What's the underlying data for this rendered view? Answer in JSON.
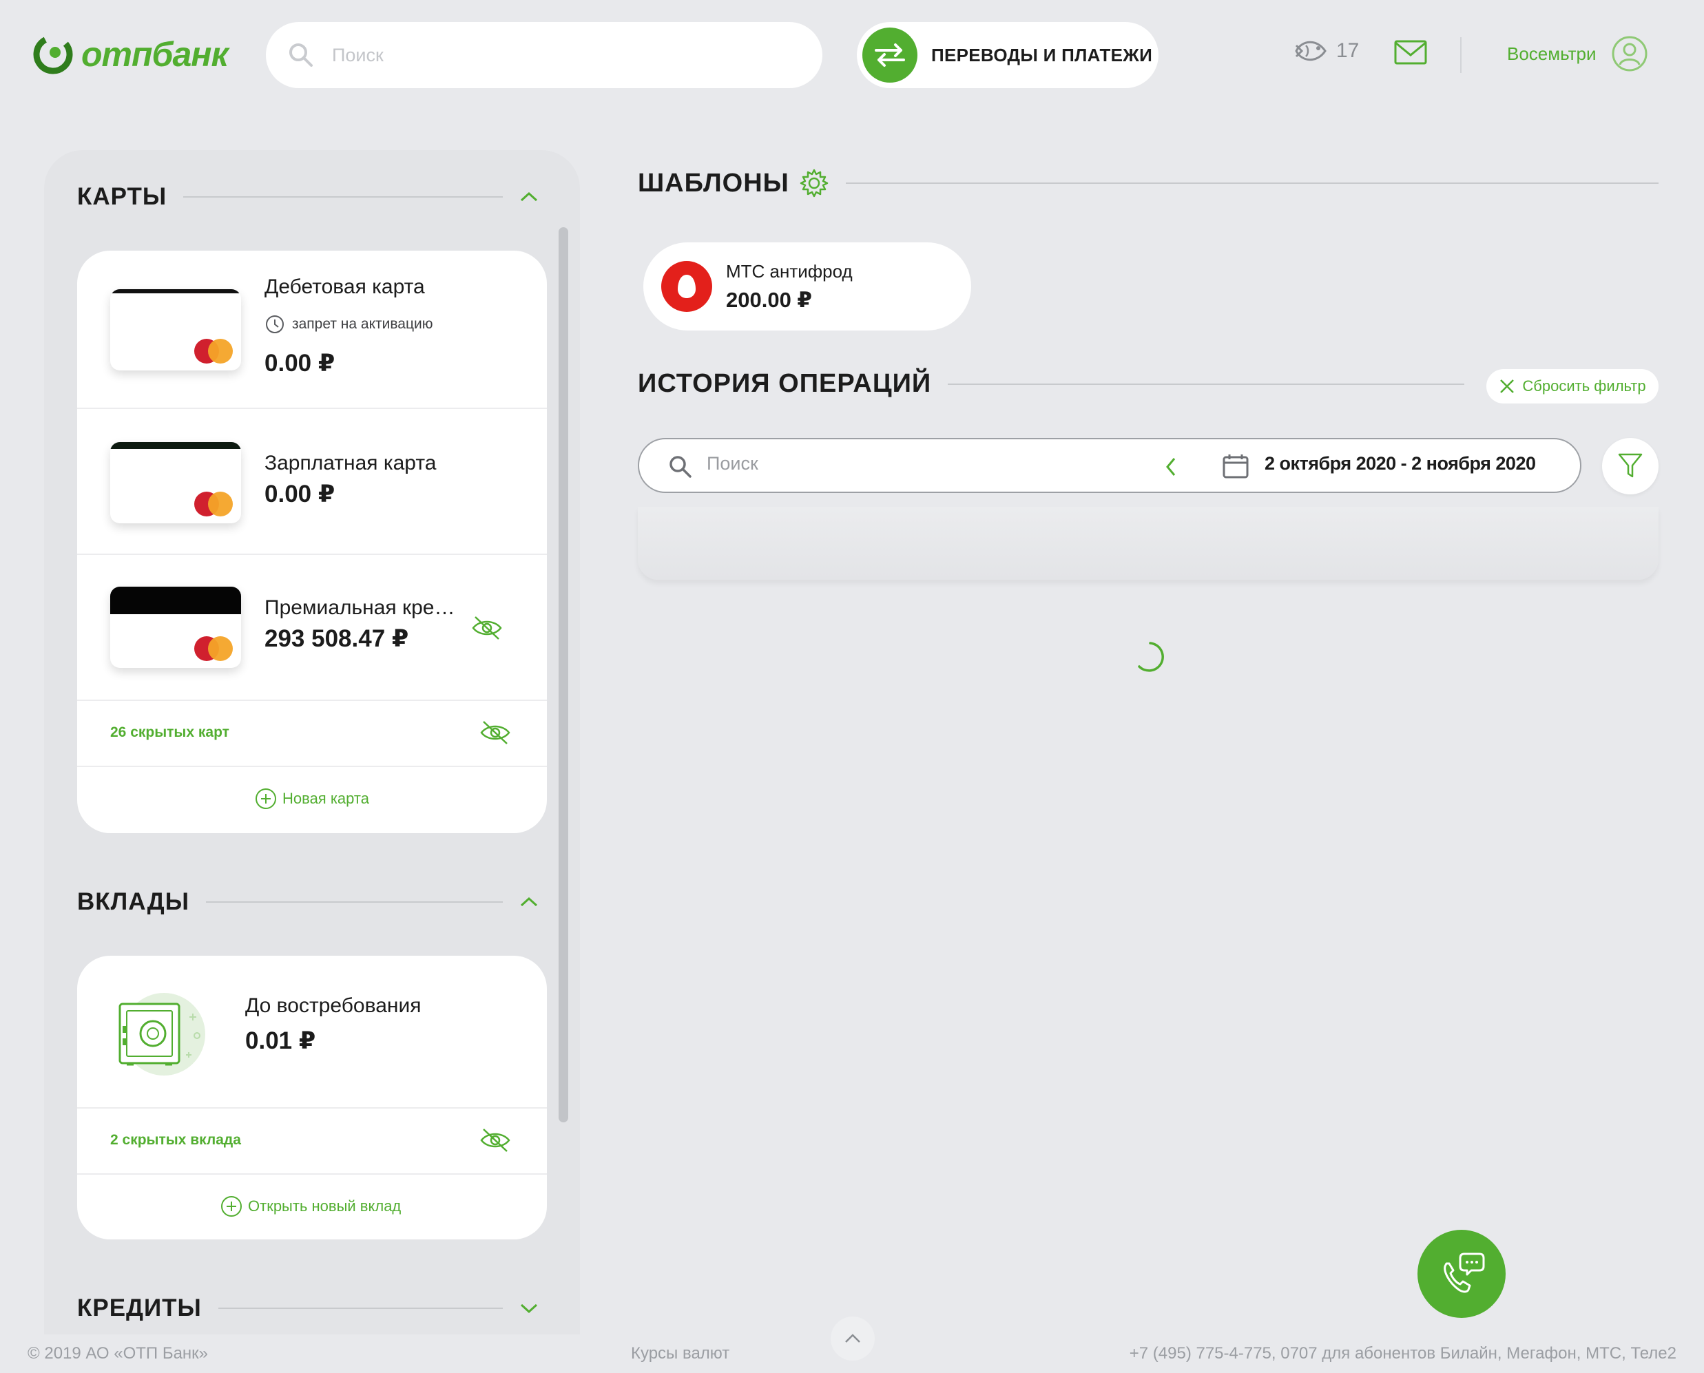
{
  "header": {
    "logo_text": "отпбанк",
    "search_placeholder": "Поиск",
    "transfers_label": "ПЕРЕВОДЫ И ПЛАТЕЖИ",
    "notifications_count": "17",
    "user_name": "Восемьтри"
  },
  "cards_section": {
    "title": "КАРТЫ",
    "items": [
      {
        "name": "Дебетовая карта",
        "status": "запрет на активацию",
        "amount": "0.00 ₽"
      },
      {
        "name": "Зарплатная карта",
        "amount": "0.00 ₽"
      },
      {
        "name": "Премиальная кре…",
        "amount": "293 508.47 ₽"
      }
    ],
    "hidden_label": "26 скрытых карт",
    "new_label": "Новая карта"
  },
  "deposits_section": {
    "title": "ВКЛАДЫ",
    "items": [
      {
        "name": "До востребования",
        "amount": "0.01 ₽"
      }
    ],
    "hidden_label": "2 скрытых вклада",
    "new_label": "Открыть новый вклад"
  },
  "credits_section": {
    "title": "КРЕДИТЫ"
  },
  "templates": {
    "title": "ШАБЛОНЫ",
    "items": [
      {
        "name": "МТС антифрод",
        "amount": "200.00 ₽"
      }
    ]
  },
  "history": {
    "title": "ИСТОРИЯ ОПЕРАЦИЙ",
    "reset_filter": "Сбросить фильтр",
    "search_placeholder": "Поиск",
    "date_range": "2 октября 2020 - 2 ноября 2020"
  },
  "footer": {
    "copyright": "© 2019 АО «ОТП Банк»",
    "rates": "Курсы валют",
    "phones": "+7 (495) 775-4-775,   0707 для абонентов Билайн, Мегафон, МТС, Теле2"
  },
  "colors": {
    "accent": "#52ae30",
    "background": "#e8e9ec",
    "mts_red": "#e3201b"
  }
}
